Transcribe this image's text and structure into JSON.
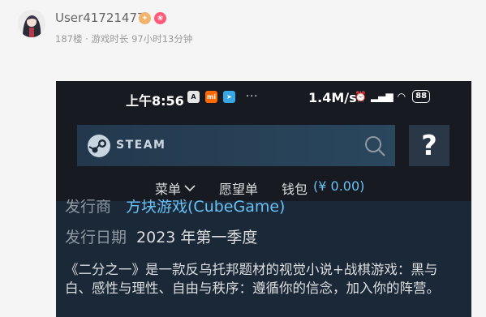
{
  "post": {
    "username": "User41721477",
    "meta": "187楼 · 游戏时长 97小时13分钟"
  },
  "status_bar": {
    "time": "上午8:56",
    "app_icons": [
      "a-icon",
      "mi-icon",
      "telegram-icon"
    ],
    "more": "···",
    "speed": "1.4M/s",
    "battery": "88"
  },
  "steam": {
    "logo_text": "STEAM",
    "help_label": "?",
    "nav": {
      "menu": "菜单",
      "wishlist": "愿望单",
      "wallet": "钱包",
      "wallet_balance": "(¥ 0.00)"
    }
  },
  "game": {
    "publisher_label": "发行商",
    "publisher_value": "方块游戏(CubeGame)",
    "release_label": "发行日期",
    "release_value": "2023 年第一季度",
    "description": "《二分之一》是一款反乌托邦题材的视觉小说+战棋游戏：黑与白、感性与理性、自由与秩序：遵循你的信念，加入你的阵营。"
  },
  "colors": {
    "steam_dark": "#171a21",
    "steam_bg": "#1b2838",
    "steam_link": "#67c1f5"
  }
}
